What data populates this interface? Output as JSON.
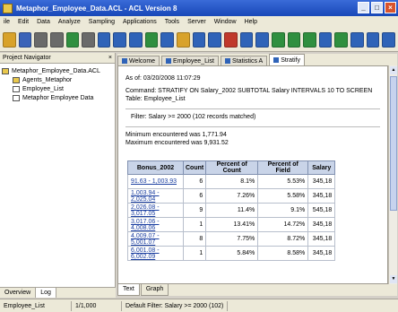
{
  "window": {
    "title": "Metaphor_Employee_Data.ACL - ACL Version 8"
  },
  "menu": [
    "ile",
    "Edit",
    "Data",
    "Analyze",
    "Sampling",
    "Applications",
    "Tools",
    "Server",
    "Window",
    "Help"
  ],
  "toolbar": {
    "buttons": [
      {
        "icon": "folder-icon",
        "color": "#d8a22a"
      },
      {
        "icon": "save-icon",
        "color": "#3b63b8"
      },
      {
        "icon": "print-icon",
        "color": "#6a6a6a"
      },
      {
        "icon": "print-preview-icon",
        "color": "#6a6a6a"
      },
      {
        "icon": "chart-icon",
        "color": "#2f8f3f"
      },
      {
        "icon": "tools-icon",
        "color": "#6a6a6a"
      },
      {
        "icon": "table-icon",
        "color": "#2f63b8"
      },
      {
        "icon": "edit-table-icon",
        "color": "#2f63b8"
      },
      {
        "icon": "filter-icon",
        "color": "#2f63b8"
      },
      {
        "icon": "refresh-icon",
        "color": "#2f8f3f"
      },
      {
        "icon": "index-icon",
        "color": "#2f63b8"
      },
      {
        "icon": "count-icon",
        "color": "#d8a22a"
      },
      {
        "icon": "total-icon",
        "color": "#2f63b8"
      },
      {
        "icon": "statistics-icon",
        "color": "#2f63b8"
      },
      {
        "icon": "sample-icon",
        "color": "#c0392b"
      },
      {
        "icon": "stratify-icon",
        "color": "#2f63b8"
      },
      {
        "icon": "age-icon",
        "color": "#2f63b8"
      },
      {
        "icon": "classify-icon",
        "color": "#2f8f3f"
      },
      {
        "icon": "histogram-icon",
        "color": "#2f8f3f"
      },
      {
        "icon": "sum-icon",
        "color": "#2f8f3f"
      },
      {
        "icon": "duplicates-icon",
        "color": "#2f63b8"
      },
      {
        "icon": "gaps-icon",
        "color": "#2f8f3f"
      },
      {
        "icon": "join-icon",
        "color": "#2f63b8"
      },
      {
        "icon": "merge-icon",
        "color": "#2f63b8"
      },
      {
        "icon": "help-icon",
        "color": "#2f63b8"
      }
    ]
  },
  "navigator": {
    "header": "Project Navigator",
    "close": "×",
    "root": "Metaphor_Employee_Data.ACL",
    "items": [
      "Agents_Metaphor",
      "Employee_List",
      "Metaphor Employee Data"
    ],
    "tabs": [
      "Overview",
      "Log"
    ]
  },
  "tabs": [
    {
      "label": "Welcome"
    },
    {
      "label": "Employee_List"
    },
    {
      "label": "Statistics A"
    },
    {
      "label": "Stratify"
    }
  ],
  "content": {
    "line1": "As of: 03/20/2008 11:07:29",
    "line2": "Command: STRATIFY ON Salary_2002 SUBTOTAL Salary INTERVALS 10 TO SCREEN",
    "line3": "Table: Employee_List",
    "filter": "Filter: Salary >= 2000 (102 records matched)",
    "min": "Minimum encountered was 1,771.94",
    "max": "Maximum encountered was 9,931.52",
    "table": {
      "headers": [
        "Bonus_2002",
        "Count",
        "Percent of Count",
        "Percent of Field",
        "Salary"
      ],
      "rows": [
        [
          "91.63 - 1,003.93",
          "6",
          "8.1%",
          "5.53%",
          "345,18"
        ],
        [
          "1,003.94 - 2,025.04",
          "6",
          "7.26%",
          "5.58%",
          "345,18"
        ],
        [
          "2,026.08 - 3,017.05",
          "9",
          "11.4%",
          "9.1%",
          "545,18"
        ],
        [
          "3,017.06 - 4,008.06",
          "1",
          "13.41%",
          "14.72%",
          "345,18"
        ],
        [
          "4,009.07 - 5,001.07",
          "8",
          "7.75%",
          "8.72%",
          "345,18"
        ],
        [
          "6,001.08 - 6,002.09",
          "1",
          "5.84%",
          "8.58%",
          "345,18"
        ]
      ]
    }
  },
  "bottom_tabs": [
    "Text",
    "Graph"
  ],
  "status": [
    "Employee_List",
    "1/1,000",
    "Default Filter: Salary >= 2000 (102)"
  ]
}
